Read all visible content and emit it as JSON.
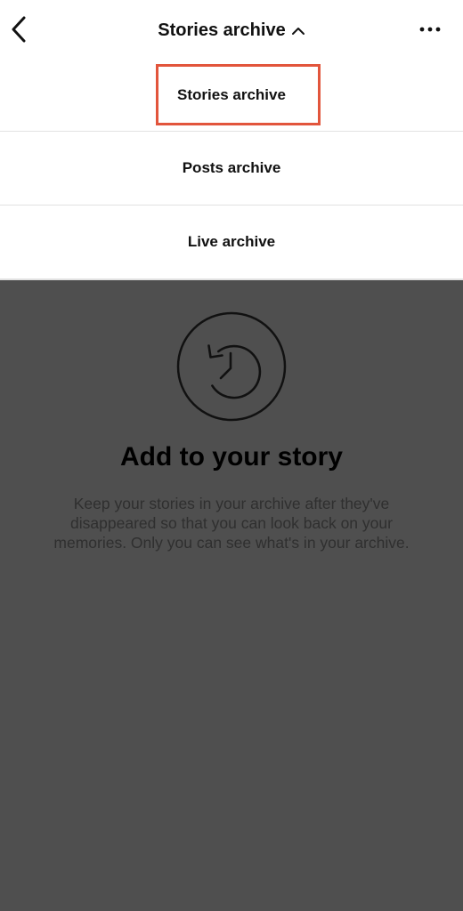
{
  "header": {
    "title": "Stories archive",
    "back_icon": "chevron-left-icon",
    "title_chevron_icon": "chevron-up-icon",
    "more_icon": "more-horizontal-icon"
  },
  "dropdown": {
    "items": [
      {
        "label": "Stories archive",
        "selected": true
      },
      {
        "label": "Posts archive",
        "selected": false
      },
      {
        "label": "Live archive",
        "selected": false
      }
    ],
    "highlight_color": "#e2553c"
  },
  "empty_state": {
    "icon": "history-icon",
    "title": "Add to your story",
    "body": "Keep your stories in your archive after they've disappeared so that you can look back on your memories. Only you can see what's in your archive."
  },
  "colors": {
    "overlay": "#4f4f4f",
    "surface": "#ffffff",
    "text": "#111111"
  }
}
